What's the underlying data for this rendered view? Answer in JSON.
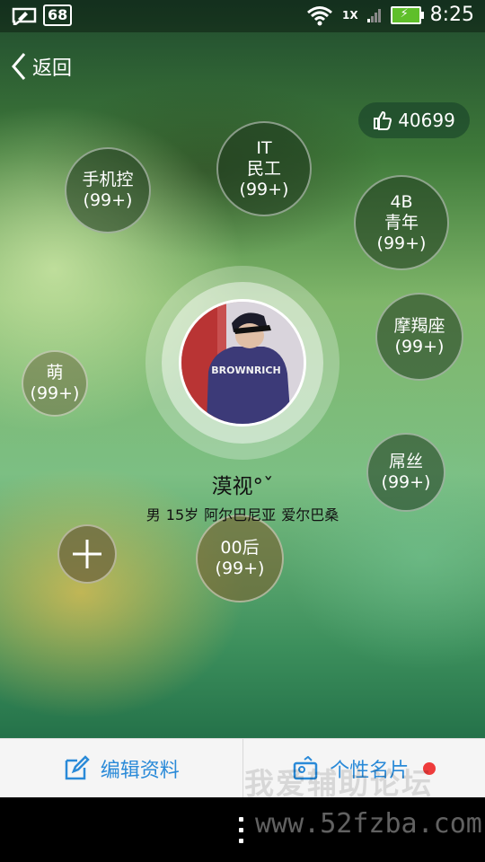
{
  "status_bar": {
    "notification_count": "68",
    "network_label": "1X",
    "time": "8:25"
  },
  "header": {
    "back_label": "返回"
  },
  "likes": {
    "count": "40699",
    "icon": "thumbs-up-icon"
  },
  "tags": [
    {
      "line1": "手机控",
      "line2": "(99+)"
    },
    {
      "line1": "IT",
      "line2": "民工",
      "line3": "(99+)"
    },
    {
      "line1": "4B",
      "line2": "青年",
      "line3": "(99+)"
    },
    {
      "line1": "摩羯座",
      "line2": "(99+)"
    },
    {
      "line1": "萌",
      "line2": "(99+)"
    },
    {
      "line1": "屌丝",
      "line2": "(99+)"
    },
    {
      "line1": "00后",
      "line2": "(99+)"
    }
  ],
  "profile": {
    "nickname": "漠视°ˇ",
    "gender": "男",
    "age": "15岁",
    "location1": "阿尔巴尼亚",
    "location2": "爱尔巴桑",
    "avatar_text": "BROWNRICH"
  },
  "bottom_bar": {
    "edit_label": "编辑资料",
    "card_label": "个性名片",
    "accent_color": "#2a8ad8",
    "dot_color": "#ee3b3b"
  },
  "watermark": {
    "cn": "我爱辅助论坛",
    "url": "www.52fzba.com"
  }
}
